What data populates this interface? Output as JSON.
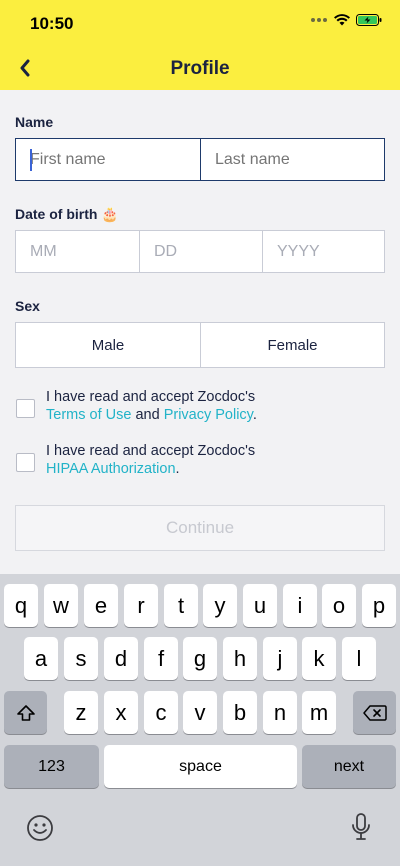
{
  "status_bar": {
    "time": "10:50"
  },
  "nav": {
    "title": "Profile"
  },
  "name": {
    "label": "Name",
    "first_placeholder": "First name",
    "last_placeholder": "Last name"
  },
  "dob": {
    "label": "Date of birth 🎂",
    "mm": "MM",
    "dd": "DD",
    "yyyy": "YYYY"
  },
  "sex": {
    "label": "Sex",
    "male": "Male",
    "female": "Female"
  },
  "consent_terms": {
    "text": "I have read and accept Zocdoc's",
    "terms_link": "Terms of Use",
    "and": "and",
    "privacy_link": "Privacy Policy",
    "period": "."
  },
  "consent_hipaa": {
    "text": "I have read and accept Zocdoc's",
    "hipaa_link": "HIPAA Authorization",
    "period": "."
  },
  "continue_label": "Continue",
  "keyboard": {
    "row1": [
      "q",
      "w",
      "e",
      "r",
      "t",
      "y",
      "u",
      "i",
      "o",
      "p"
    ],
    "row2": [
      "a",
      "s",
      "d",
      "f",
      "g",
      "h",
      "j",
      "k",
      "l"
    ],
    "row3": [
      "z",
      "x",
      "c",
      "v",
      "b",
      "n",
      "m"
    ],
    "numbers_label": "123",
    "space_label": "space",
    "next_label": "next"
  }
}
